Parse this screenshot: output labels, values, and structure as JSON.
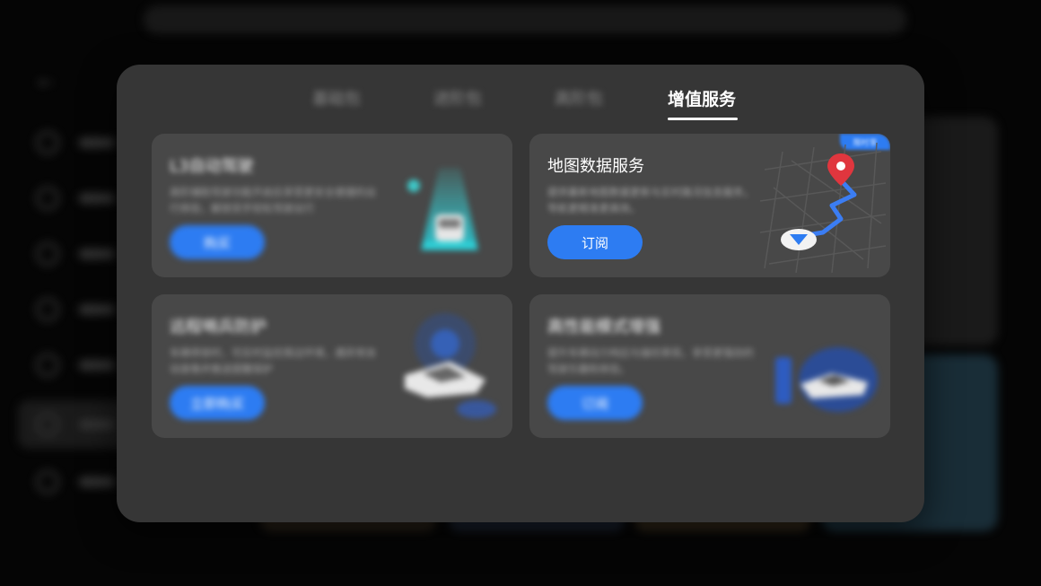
{
  "modal": {
    "tabs": [
      {
        "label": "基础包"
      },
      {
        "label": "进阶包"
      },
      {
        "label": "高阶包"
      },
      {
        "label": "增值服务"
      }
    ],
    "cards": [
      {
        "title": "L3自动驾驶",
        "desc": "高阶辅助驾驶功能开启后享受更安全便捷的出行体验，解放双手轻松驾驶出行",
        "button": "购买"
      },
      {
        "title": "地图数据服务",
        "desc": "提供最新地图数据更新与实时路况信息服务，导航更精准更高效。",
        "button": "订阅",
        "badge": "限时享"
      },
      {
        "title": "远程哨兵防护",
        "desc": "车辆停放时，可实时监控周边环境，遇异常自动录像并推送提醒保护",
        "button": "立即购买"
      },
      {
        "title": "高性能模式增强",
        "desc": "提升车辆动力响应与操控表现，享受更强劲的驾驶乐趣和体验。",
        "button": "订阅"
      }
    ]
  },
  "colors": {
    "accent": "#2d7cf2",
    "modal_bg": "#363636",
    "card_bg": "#484848",
    "pin_red": "#e0363e"
  }
}
